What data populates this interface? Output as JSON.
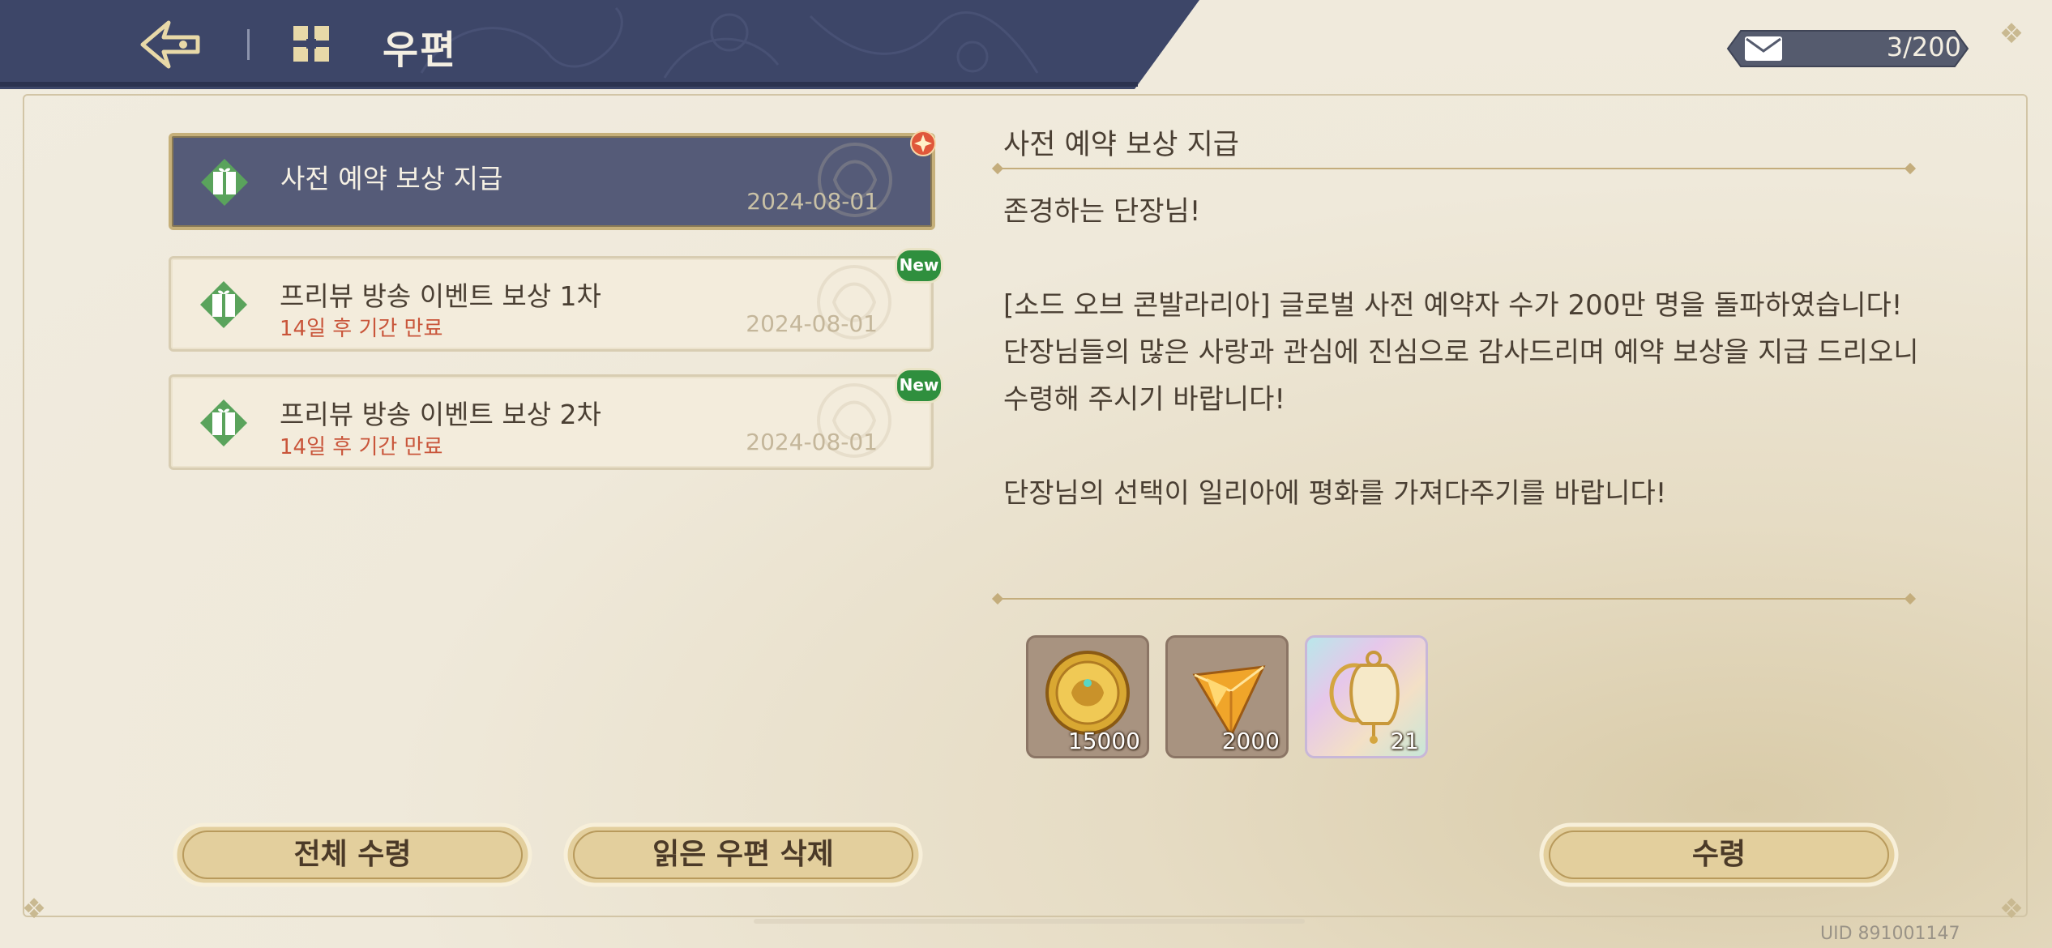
{
  "header": {
    "title": "우편"
  },
  "counter": {
    "value": "3/200"
  },
  "mails": [
    {
      "title": "사전 예약 보상 지급",
      "expire": "",
      "date": "2024-08-01",
      "selected": true,
      "new": false
    },
    {
      "title": "프리뷰 방송 이벤트 보상 1차",
      "expire": "14일 후 기간 만료",
      "date": "2024-08-01",
      "selected": false,
      "new": true
    },
    {
      "title": "프리뷰 방송 이벤트 보상 2차",
      "expire": "14일 후 기간 만료",
      "date": "2024-08-01",
      "selected": false,
      "new": true
    }
  ],
  "new_badge": "New",
  "detail": {
    "title": "사전 예약 보상 지급",
    "body": "존경하는 단장님!\n\n [소드 오브 콘발라리아] 글로벌 사전 예약자 수가 200만 명을 돌파하였습니다! 단장님들의 많은 사랑과 관심에 진심으로 감사드리며 예약 보상을 지급 드리오니 수령해 주시기 바랍니다!\n\n단장님의 선택이 일리아에 평화를 가져다주기를 바랍니다!",
    "rewards": [
      {
        "icon": "gold-coin-icon",
        "count": "15000"
      },
      {
        "icon": "gem-icon",
        "count": "2000"
      },
      {
        "icon": "bell-icon",
        "count": "21"
      }
    ]
  },
  "buttons": {
    "claim_all": "전체 수령",
    "delete_read": "읽은 우편 삭제",
    "claim": "수령"
  },
  "uid": "UID 891001147",
  "colors": {
    "header_navy": "#3d4668",
    "selected_item": "#555b78",
    "gold_border": "#c6b07a",
    "button_fill": "#e3cf9d",
    "expire_red": "#c9553a",
    "new_green": "#2f8f3e"
  }
}
